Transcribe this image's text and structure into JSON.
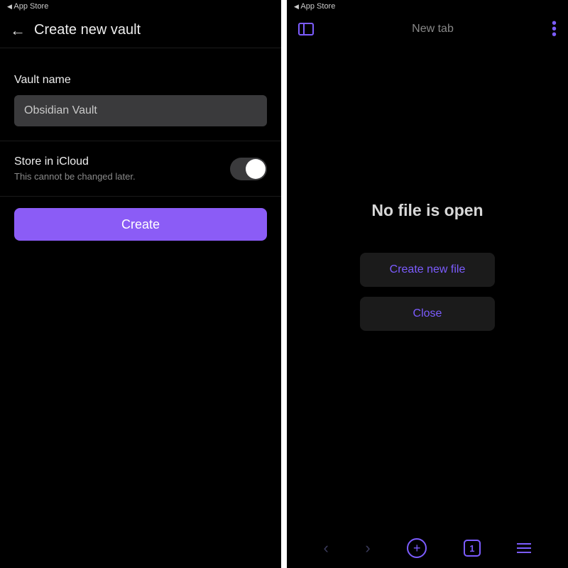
{
  "left": {
    "status_back": "App Store",
    "header_title": "Create new vault",
    "vault_name_label": "Vault name",
    "vault_name_value": "Obsidian Vault",
    "icloud_title": "Store in iCloud",
    "icloud_sub": "This cannot be changed later.",
    "create_label": "Create"
  },
  "right": {
    "status_back": "App Store",
    "tab_title": "New tab",
    "empty_msg": "No file is open",
    "create_file_label": "Create new file",
    "close_label": "Close",
    "tab_count": "1"
  },
  "colors": {
    "accent": "#7c5cff"
  }
}
